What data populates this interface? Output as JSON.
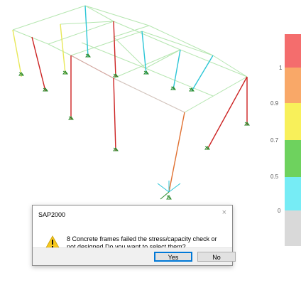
{
  "legend": {
    "colors": [
      "#f46d6d",
      "#f9a868",
      "#f8f05a",
      "#6ed25e",
      "#76ecf5",
      "#d9d9d9"
    ],
    "ticks": [
      "1",
      "0.9",
      "0.7",
      "0.5",
      "0"
    ]
  },
  "dialog": {
    "title": "SAP2000",
    "close_glyph": "×",
    "message": "8 Concrete frames failed the stress/capacity check or not designed.Do you want to select them?",
    "icon": "warning-icon",
    "yes_label": "Yes",
    "no_label": "No"
  }
}
